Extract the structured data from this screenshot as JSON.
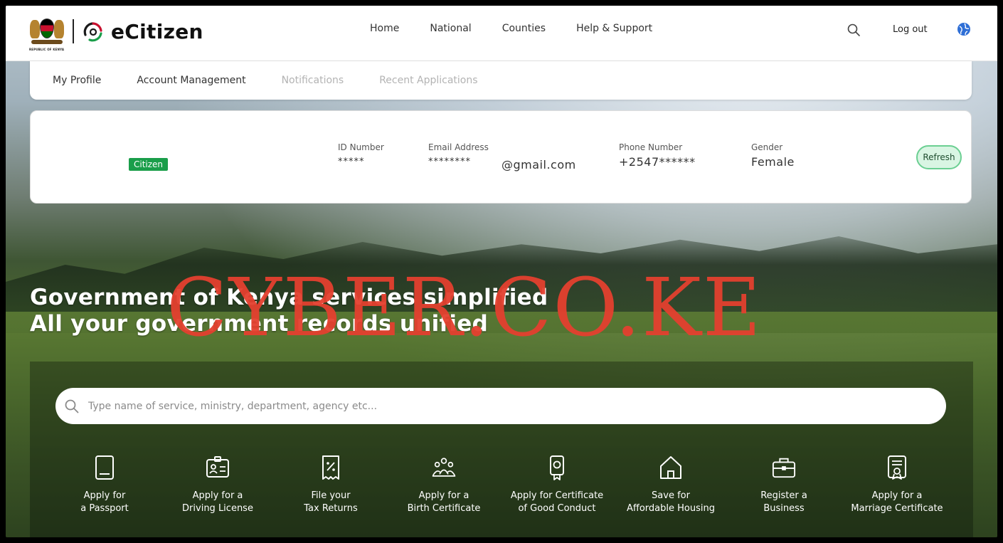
{
  "header": {
    "coat_of_arms_text": "REPUBLIC OF KENYA",
    "brand": "eCitizen",
    "nav": [
      "Home",
      "National",
      "Counties",
      "Help & Support"
    ],
    "logout": "Log out"
  },
  "profile_tabs": [
    {
      "label": "My Profile",
      "state": "active"
    },
    {
      "label": "Account Management",
      "state": "active"
    },
    {
      "label": "Notifications",
      "state": "muted"
    },
    {
      "label": "Recent Applications",
      "state": "muted"
    }
  ],
  "profile": {
    "role_badge": "Citizen",
    "id_label": "ID Number",
    "id_value": "*****",
    "email_label": "Email Address",
    "email_value": "********",
    "email_domain": "@gmail.com",
    "phone_label": "Phone Number",
    "phone_value": "+2547******",
    "gender_label": "Gender",
    "gender_value": "Female",
    "refresh": "Refresh"
  },
  "hero": {
    "line1": "Government of Kenya services simplified",
    "line2": "All your government records unified"
  },
  "watermark": "CYBER.CO.KE",
  "search": {
    "placeholder": "Type name of service, ministry, department, agency etc..."
  },
  "services": [
    {
      "line1": "Apply for",
      "line2": "a Passport",
      "icon": "passport-icon"
    },
    {
      "line1": "Apply for a",
      "line2": "Driving License",
      "icon": "id-card-icon"
    },
    {
      "line1": "File your",
      "line2": "Tax Returns",
      "icon": "tax-receipt-icon"
    },
    {
      "line1": "Apply for a",
      "line2": "Birth Certificate",
      "icon": "family-icon"
    },
    {
      "line1": "Apply for Certificate",
      "line2": "of Good Conduct",
      "icon": "certificate-badge-icon"
    },
    {
      "line1": "Save for",
      "line2": "Affordable Housing",
      "icon": "house-icon"
    },
    {
      "line1": "Register a",
      "line2": "Business",
      "icon": "briefcase-icon"
    },
    {
      "line1": "Apply for a",
      "line2": "Marriage Certificate",
      "icon": "marriage-certificate-icon"
    }
  ],
  "colors": {
    "badge_green": "#1a9e4a",
    "refresh_bg": "#d9f5e3",
    "watermark_red": "#e4402f"
  }
}
